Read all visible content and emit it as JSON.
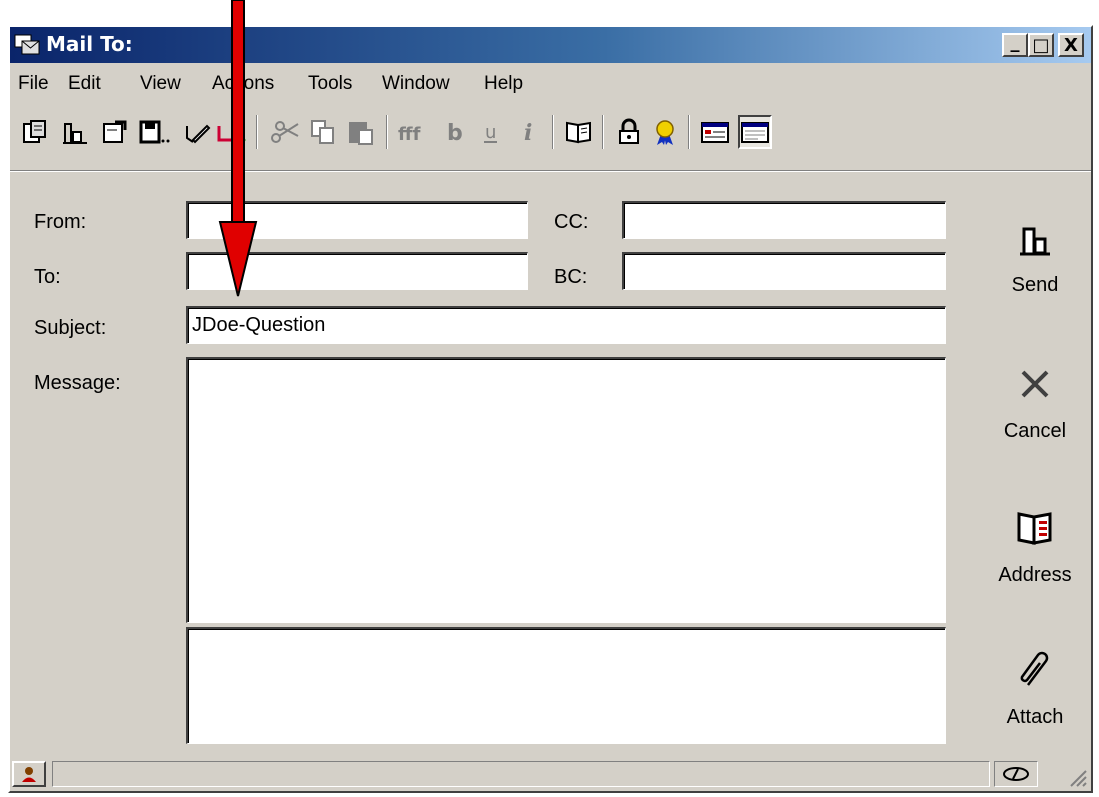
{
  "window": {
    "title": "Mail To:"
  },
  "title_buttons": {
    "minimize": "_",
    "maximize": "□",
    "close": "X"
  },
  "menu": [
    "File",
    "Edit",
    "View",
    "Actions",
    "Tools",
    "Window",
    "Help"
  ],
  "toolbar_icons": [
    "open-mail-icon",
    "send-icon",
    "properties-icon",
    "save-draft-icon",
    "spell-check-icon",
    "reply-icon",
    "cut-icon",
    "copy-icon",
    "paste-icon",
    "font-icon",
    "bold-icon",
    "underline-icon",
    "italic-icon",
    "address-book-icon",
    "lock-icon",
    "certificate-icon",
    "select-names-icon",
    "plain-text-view-icon",
    "html-view-icon"
  ],
  "form": {
    "from_label": "From:",
    "to_label": "To:",
    "subject_label": "Subject:",
    "message_label": "Message:",
    "cc_label": "CC:",
    "bc_label": "BC:",
    "from_value": "",
    "to_value": "",
    "cc_value": "",
    "bc_value": "",
    "subject_value": "JDoe-Question",
    "message_value": ""
  },
  "actions": {
    "send": "Send",
    "cancel": "Cancel",
    "address": "Address",
    "attach": "Attach"
  },
  "colors": {
    "titlebar_start": "#0a246a",
    "titlebar_end": "#a6caf0",
    "chrome": "#d4d0c8",
    "arrow": "#e00000"
  }
}
